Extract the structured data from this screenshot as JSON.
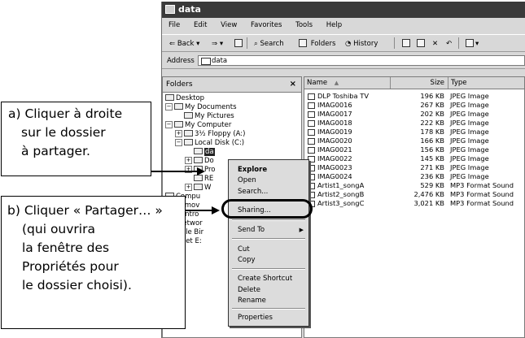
{
  "window": {
    "title": "data"
  },
  "menubar": [
    "File",
    "Edit",
    "View",
    "Favorites",
    "Tools",
    "Help"
  ],
  "toolbar": {
    "back": "Back",
    "search": "Search",
    "folders": "Folders",
    "history": "History"
  },
  "address": {
    "label": "Address",
    "value": "data"
  },
  "folders_pane": {
    "title": "Folders",
    "close": "×",
    "items": [
      "Desktop",
      "My Documents",
      "My Pictures",
      "My Computer",
      "3½ Floppy (A:)",
      "Local Disk (C:)",
      "da",
      "Do",
      "Pro",
      "RE",
      "W",
      "Compu",
      "Remov",
      "Contro",
      "My Networ",
      "Recycle Bir",
      "Internet E:"
    ]
  },
  "file_list": {
    "columns": {
      "name": "Name",
      "size": "Size",
      "type": "Type"
    },
    "rows": [
      {
        "name": "DLP Toshiba TV",
        "size": "196 KB",
        "type": "JPEG Image"
      },
      {
        "name": "IMAG0016",
        "size": "267 KB",
        "type": "JPEG Image"
      },
      {
        "name": "IMAG0017",
        "size": "202 KB",
        "type": "JPEG Image"
      },
      {
        "name": "IMAG0018",
        "size": "222 KB",
        "type": "JPEG Image"
      },
      {
        "name": "IMAG0019",
        "size": "178 KB",
        "type": "JPEG Image"
      },
      {
        "name": "IMAG0020",
        "size": "166 KB",
        "type": "JPEG Image"
      },
      {
        "name": "IMAG0021",
        "size": "156 KB",
        "type": "JPEG Image"
      },
      {
        "name": "IMAG0022",
        "size": "145 KB",
        "type": "JPEG Image"
      },
      {
        "name": "IMAG0023",
        "size": "271 KB",
        "type": "JPEG Image"
      },
      {
        "name": "IMAG0024",
        "size": "236 KB",
        "type": "JPEG Image"
      },
      {
        "name": "Artist1_songA",
        "size": "529 KB",
        "type": "MP3 Format Sound"
      },
      {
        "name": "Artist2_songB",
        "size": "2,476 KB",
        "type": "MP3 Format Sound"
      },
      {
        "name": "Artist3_songC",
        "size": "3,021 KB",
        "type": "MP3 Format Sound"
      }
    ]
  },
  "context_menu": {
    "explore": "Explore",
    "open": "Open",
    "search": "Search...",
    "sharing": "Sharing...",
    "send_to": "Send To",
    "cut": "Cut",
    "copy": "Copy",
    "create_shortcut": "Create Shortcut",
    "delete": "Delete",
    "rename": "Rename",
    "properties": "Properties"
  },
  "callout_a": [
    "a) Cliquer à droite",
    "sur le dossier",
    "à partager."
  ],
  "callout_b": [
    "b) Cliquer « Partager… »",
    "(qui ouvrira",
    "la fenêtre des",
    "Propriétés pour",
    "le dossier choisi)."
  ]
}
